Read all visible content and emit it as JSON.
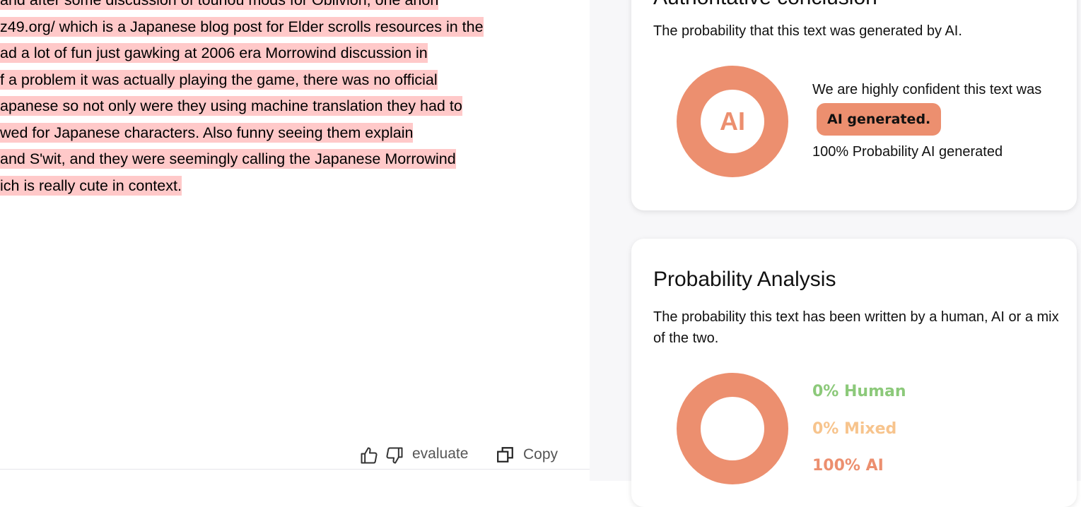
{
  "text_lines": [
    "and after some discussion of touhou mods for Oblivion, one anon",
    "z49.org/ which is a Japanese blog post for Elder scrolls resources in the",
    "ad a lot of fun just gawking at 2006 era Morrowind discussion in",
    "f a problem it was actually playing the game, there was no official",
    "apanese so not only were they using machine translation they had to",
    "wed for Japanese characters. Also funny seeing them explain",
    " and S'wit, and they were seemingly calling the Japanese Morrowind",
    "ich is really cute in context."
  ],
  "toolbar": {
    "evaluate_label": "evaluate",
    "copy_label": "Copy"
  },
  "confidence": {
    "title": "Authoritative conclusion",
    "description": "The probability that this text was generated by AI.",
    "donut_label": "AI",
    "verdict_prefix": "We are highly confident this text was",
    "verdict_pill": "AI generated.",
    "probability_text": "100% Probability AI generated",
    "ai_fraction": 1.0
  },
  "analysis": {
    "title": "Probability Analysis",
    "description": "The probability this text has been written by a human, AI or a mix of the two.",
    "human_label": "0% Human",
    "mixed_label": "0% Mixed",
    "ai_label": "100% AI",
    "human_value": 0,
    "mixed_value": 0,
    "ai_value": 100
  },
  "colors": {
    "highlight": "#ffc9c9",
    "ai": "#ec8f6f",
    "human": "#8cc97a",
    "mixed": "#f7c48d"
  }
}
